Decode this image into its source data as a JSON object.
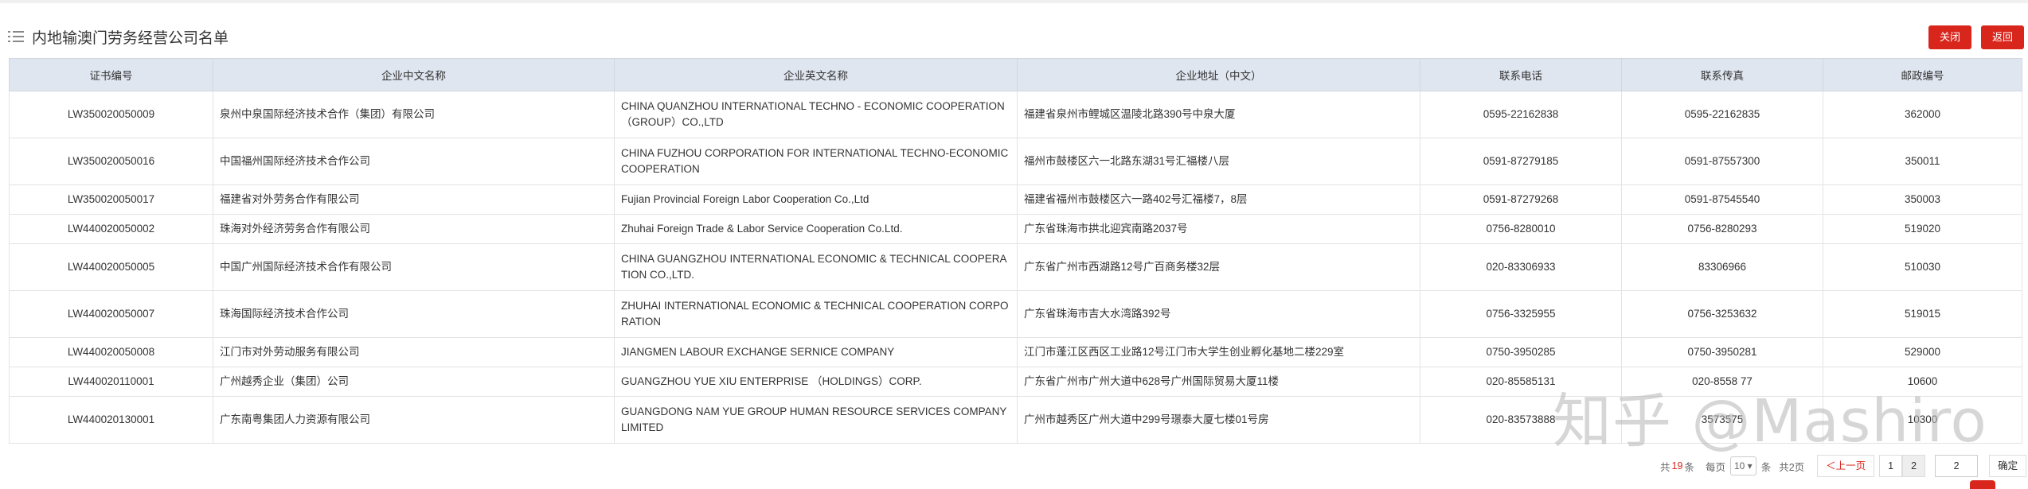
{
  "header": {
    "title": "内地输澳门劳务经营公司名单",
    "icon": "list-icon"
  },
  "buttons": {
    "close": "关闭",
    "back": "返回"
  },
  "colors": {
    "accent": "#d9261c",
    "header_bg": "#dfe6f0"
  },
  "table": {
    "columns": [
      "证书编号",
      "企业中文名称",
      "企业英文名称",
      "企业地址（中文）",
      "联系电话",
      "联系传真",
      "邮政编号"
    ],
    "rows": [
      [
        "LW350020050009",
        "泉州中泉国际经济技术合作（集团）有限公司",
        "CHINA QUANZHOU INTERNATIONAL TECHNO - ECONOMIC COOPERATION（GROUP）CO.,LTD",
        "福建省泉州市鲤城区温陵北路390号中泉大厦",
        "0595-22162838",
        "0595-22162835",
        "362000"
      ],
      [
        "LW350020050016",
        "中国福州国际经济技术合作公司",
        "CHINA FUZHOU CORPORATION FOR INTERNATIONAL TECHNO-ECONOMIC COOPERATION",
        "福州市鼓楼区六一北路东湖31号汇福楼八层",
        "0591-87279185",
        "0591-87557300",
        "350011"
      ],
      [
        "LW350020050017",
        "福建省对外劳务合作有限公司",
        "Fujian Provincial Foreign Labor Cooperation Co.,Ltd",
        "福建省福州市鼓楼区六一路402号汇福楼7，8层",
        "0591-87279268",
        "0591-87545540",
        "350003"
      ],
      [
        "LW440020050002",
        "珠海对外经济劳务合作有限公司",
        "Zhuhai Foreign Trade & Labor Service Cooperation Co.Ltd.",
        "广东省珠海市拱北迎宾南路2037号",
        "0756-8280010",
        "0756-8280293",
        "519020"
      ],
      [
        "LW440020050005",
        "中国广州国际经济技术合作有限公司",
        "CHINA GUANGZHOU INTERNATIONAL ECONOMIC & TECHNICAL COOPERATION CO.,LTD.",
        "广东省广州市西湖路12号广百商务楼32层",
        "020-83306933",
        "83306966",
        "510030"
      ],
      [
        "LW440020050007",
        "珠海国际经济技术合作公司",
        "ZHUHAI INTERNATIONAL ECONOMIC & TECHNICAL COOPERATION CORPORATION",
        "广东省珠海市吉大水湾路392号",
        "0756-3325955",
        "0756-3253632",
        "519015"
      ],
      [
        "LW440020050008",
        "江门市对外劳动服务有限公司",
        "JIANGMEN LABOUR EXCHANGE SERNICE COMPANY",
        "江门市蓬江区西区工业路12号江门市大学生创业孵化基地二楼229室",
        "0750-3950285",
        "0750-3950281",
        "529000"
      ],
      [
        "LW440020110001",
        "广州越秀企业（集团）公司",
        "GUANGZHOU YUE XIU ENTERPRISE （HOLDINGS）CORP.",
        "广东省广州市广州大道中628号广州国际贸易大厦11楼",
        "020-85585131",
        "020-8558 77",
        "10600"
      ],
      [
        "LW440020130001",
        "广东南粤集团人力资源有限公司",
        "GUANGDONG NAM YUE GROUP HUMAN RESOURCE SERVICES COMPANY LIMITED",
        "广州市越秀区广州大道中299号璟泰大厦七楼01号房",
        "020-83573888",
        "3573575",
        "10300"
      ]
    ]
  },
  "pager": {
    "total_prefix": "共",
    "total": "19",
    "total_suffix": "条",
    "per_page_label": "每页",
    "per_page": "10",
    "per_page_suffix": "条",
    "pages_total": "共2页",
    "prev": "＜上一页",
    "page1": "1",
    "page2": "2",
    "jump_value": "2",
    "confirm": "确定"
  },
  "watermark": "知乎 @Mashiro"
}
